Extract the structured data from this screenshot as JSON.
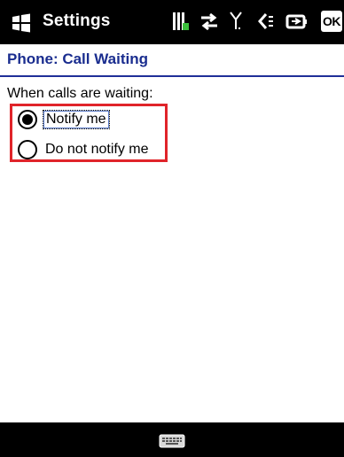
{
  "titlebar": {
    "app_title": "Settings",
    "ok_label": "OK",
    "icons": [
      "windows-logo-icon",
      "battery-icon",
      "connectivity-icon",
      "signal-icon",
      "volume-icon",
      "charging-icon"
    ]
  },
  "header": {
    "title": "Phone: Call Waiting"
  },
  "main": {
    "section_label": "When calls are waiting:",
    "options": [
      {
        "label": "Notify me",
        "selected": true
      },
      {
        "label": "Do not notify me",
        "selected": false
      }
    ]
  },
  "bottombar": {
    "icon": "keyboard-icon"
  },
  "colors": {
    "header_text": "#1a2d8f",
    "highlight": "#e0242a",
    "bar": "#000000"
  }
}
